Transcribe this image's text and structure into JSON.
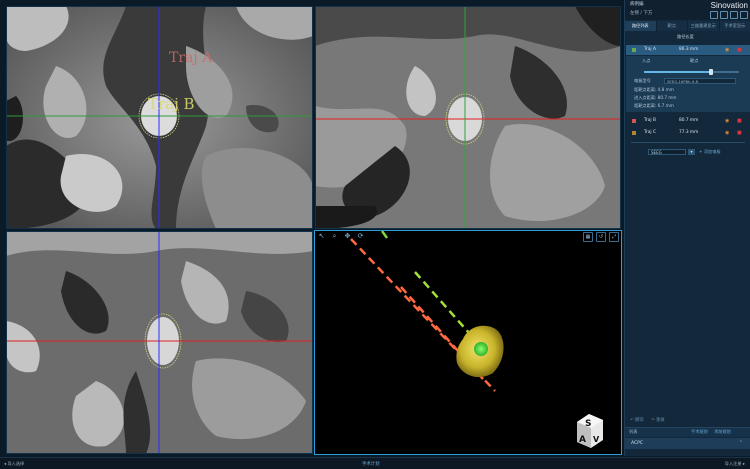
{
  "app": {
    "brand": "Sinovation",
    "user_name": "病例编",
    "user_sub": "左侧 / 下方",
    "brand_color": "#2d9fd6"
  },
  "viewports": {
    "axial": {
      "labels": [
        "Traj B",
        "Traj A"
      ]
    },
    "render3d": {
      "toolbar": [
        "pointer-icon",
        "zoom-icon",
        "pan-icon",
        "rotate-icon"
      ],
      "toolbar_right": [
        "layout-icon",
        "reset-icon",
        "fullscreen-icon"
      ],
      "orientation_cube": [
        "S",
        "A",
        "V"
      ]
    }
  },
  "panel": {
    "tabs": [
      {
        "label": "路径列表",
        "active": true
      },
      {
        "label": "靶点",
        "active": false
      },
      {
        "label": "三维重建显示",
        "active": false
      },
      {
        "label": "手术室显示",
        "active": false
      }
    ],
    "list_header": "路径长度",
    "trajectories": [
      {
        "name": "Traj A",
        "length": "86.3 mm",
        "color": "#6aa84f",
        "selected": true
      },
      {
        "name": "Traj B",
        "length": "80.7 mm",
        "color": "#d9534f",
        "selected": false
      },
      {
        "name": "Traj C",
        "length": "77.3 mm",
        "color": "#b3862e",
        "selected": false
      }
    ],
    "detail": {
      "entry_label": "入点",
      "target_label": "靶点",
      "electrode_label": "电极型号",
      "electrode_value": "SEEG-16P8h-9-8",
      "dist1": "距靶点距离: 4.8 mm",
      "dist2": "进入点距离: 80.7 mm",
      "dist3": "距靶点距离: 6.7 mm",
      "slider_value": 0.7
    },
    "seeg_value": "SEEG",
    "add_label": "添加电极",
    "undo_label": "撤销",
    "redo_label": "重做",
    "bar1": {
      "a": "列表",
      "b": "手术规划",
      "c": "术前规划"
    },
    "section": "ACPC"
  },
  "bottom": {
    "left": "导入选择",
    "middle": "手术计划",
    "right": "导入注册"
  }
}
